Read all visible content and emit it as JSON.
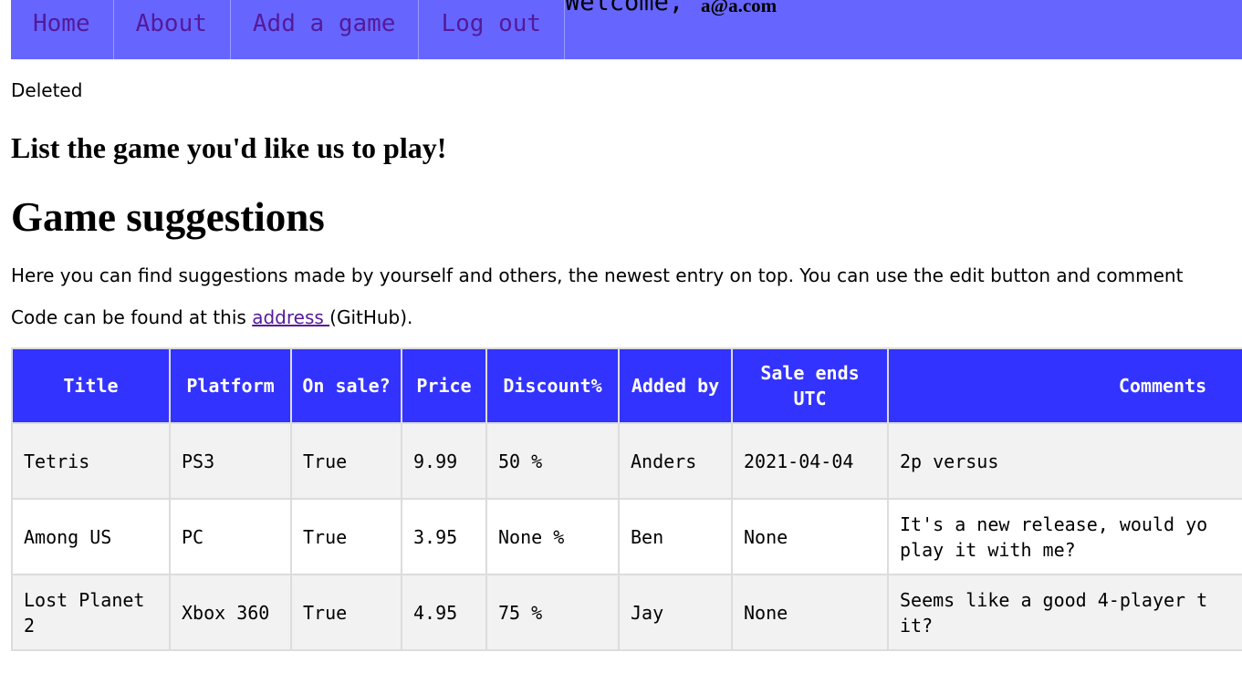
{
  "nav": {
    "items": [
      "Home",
      "About",
      "Add a game",
      "Log out"
    ],
    "welcome_label": "Welcome,",
    "welcome_email": "a@a.com"
  },
  "flash_message": "Deleted",
  "headings": {
    "list_game": "List the game you'd like us to play!",
    "suggestions": "Game suggestions"
  },
  "intro_text": "Here you can find suggestions made by yourself and others, the newest entry on top. You can use the edit button and comment",
  "code_line": {
    "prefix": "Code can be found at this ",
    "link_text": "address ",
    "suffix": "(GitHub)."
  },
  "table": {
    "headers": [
      "Title",
      "Platform",
      "On sale?",
      "Price",
      "Discount%",
      "Added by",
      "Sale ends UTC",
      "Comments"
    ],
    "rows": [
      {
        "title": "Tetris",
        "platform": "PS3",
        "on_sale": "True",
        "price": "9.99",
        "discount": "50 %",
        "added_by": "Anders",
        "sale_ends": "2021-04-04",
        "comment_line1": "2p versus",
        "comment_line2": ""
      },
      {
        "title": "Among US",
        "platform": "PC",
        "on_sale": "True",
        "price": "3.95",
        "discount": "None %",
        "added_by": "Ben",
        "sale_ends": "None",
        "comment_line1": "It's a new release, would yo",
        "comment_line2": "play it with me?"
      },
      {
        "title": "Lost Planet 2",
        "platform": "Xbox 360",
        "on_sale": "True",
        "price": "4.95",
        "discount": "75 %",
        "added_by": "Jay",
        "sale_ends": "None",
        "comment_line1": "Seems like a good 4-player t",
        "comment_line2": "it?"
      }
    ]
  },
  "colors": {
    "nav_background": "#6666ff",
    "nav_link": "#55199a",
    "table_header": "#3333ff",
    "row_shaded": "#f2f2f2",
    "grid": "#dcdcdc"
  }
}
